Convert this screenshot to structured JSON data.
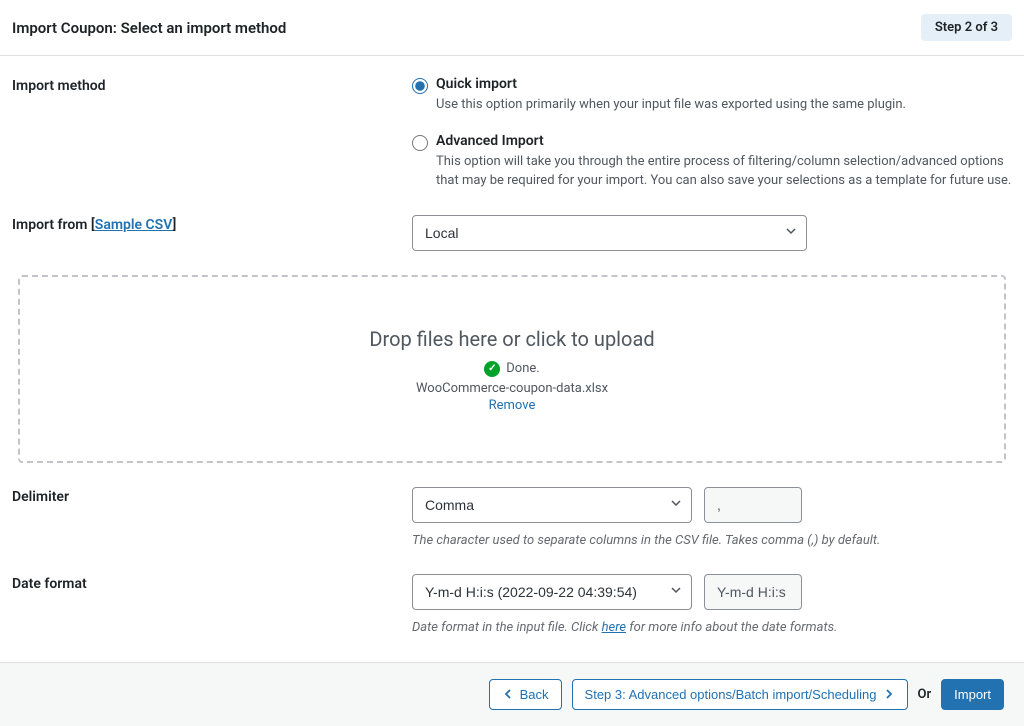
{
  "header": {
    "title": "Import Coupon: Select an import method",
    "step_badge": "Step 2 of 3"
  },
  "import_method": {
    "label": "Import method",
    "options": {
      "quick": {
        "title": "Quick import",
        "desc": "Use this option primarily when your input file was exported using the same plugin."
      },
      "advanced": {
        "title": "Advanced Import",
        "desc": "This option will take you through the entire process of filtering/column selection/advanced options that may be required for your import. You can also save your selections as a template for future use."
      }
    }
  },
  "import_from": {
    "label_prefix": "Import from [",
    "sample_link": "Sample CSV",
    "label_suffix": "]",
    "selected": "Local"
  },
  "dropzone": {
    "title": "Drop files here or click to upload",
    "done": "Done.",
    "filename": "WooCommerce-coupon-data.xlsx",
    "remove": "Remove"
  },
  "delimiter": {
    "label": "Delimiter",
    "selected": "Comma",
    "value": ",",
    "help": "The character used to separate columns in the CSV file. Takes comma (,) by default."
  },
  "date_format": {
    "label": "Date format",
    "selected": "Y-m-d H:i:s (2022-09-22 04:39:54)",
    "value": "Y-m-d H:i:s",
    "help_prefix": "Date format in the input file. Click ",
    "help_link": "here",
    "help_suffix": " for more info about the date formats."
  },
  "footer": {
    "back": "Back",
    "next": "Step 3: Advanced options/Batch import/Scheduling",
    "or": "Or",
    "import": "Import"
  }
}
